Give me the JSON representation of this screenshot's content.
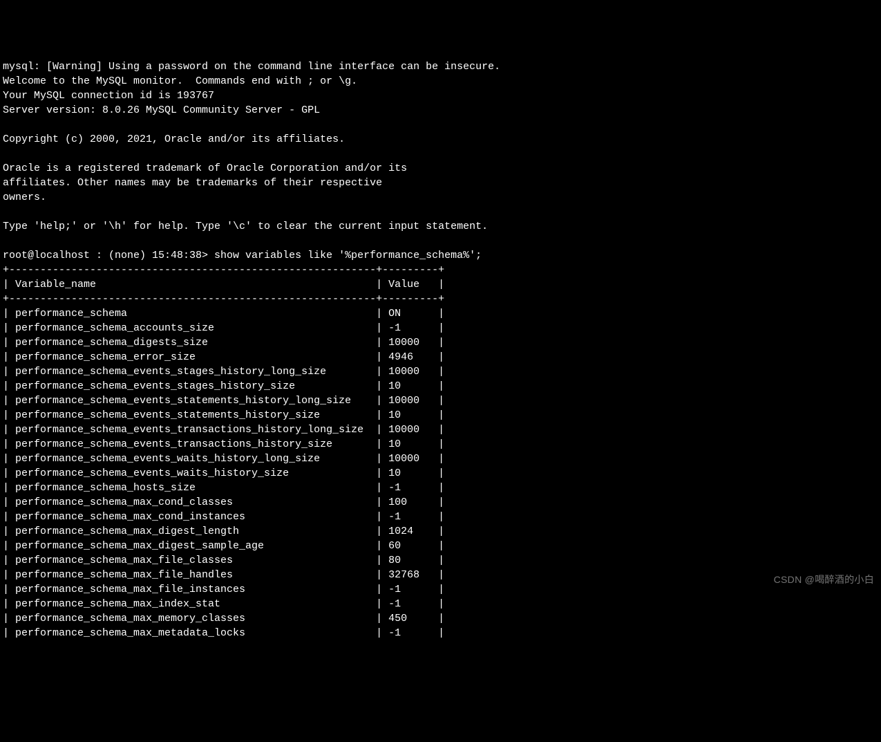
{
  "header_lines": [
    "mysql: [Warning] Using a password on the command line interface can be insecure.",
    "Welcome to the MySQL monitor.  Commands end with ; or \\g.",
    "Your MySQL connection id is 193767",
    "Server version: 8.0.26 MySQL Community Server - GPL",
    "",
    "Copyright (c) 2000, 2021, Oracle and/or its affiliates.",
    "",
    "Oracle is a registered trademark of Oracle Corporation and/or its",
    "affiliates. Other names may be trademarks of their respective",
    "owners.",
    "",
    "Type 'help;' or '\\h' for help. Type '\\c' to clear the current input statement.",
    ""
  ],
  "prompt_line": "root@localhost : (none) 15:48:38> show variables like '%performance_schema%';",
  "table": {
    "col1_header": "Variable_name",
    "col2_header": "Value",
    "col1_width": 57,
    "col2_width": 7,
    "rows": [
      {
        "name": "performance_schema",
        "value": "ON"
      },
      {
        "name": "performance_schema_accounts_size",
        "value": "-1"
      },
      {
        "name": "performance_schema_digests_size",
        "value": "10000"
      },
      {
        "name": "performance_schema_error_size",
        "value": "4946"
      },
      {
        "name": "performance_schema_events_stages_history_long_size",
        "value": "10000"
      },
      {
        "name": "performance_schema_events_stages_history_size",
        "value": "10"
      },
      {
        "name": "performance_schema_events_statements_history_long_size",
        "value": "10000"
      },
      {
        "name": "performance_schema_events_statements_history_size",
        "value": "10"
      },
      {
        "name": "performance_schema_events_transactions_history_long_size",
        "value": "10000"
      },
      {
        "name": "performance_schema_events_transactions_history_size",
        "value": "10"
      },
      {
        "name": "performance_schema_events_waits_history_long_size",
        "value": "10000"
      },
      {
        "name": "performance_schema_events_waits_history_size",
        "value": "10"
      },
      {
        "name": "performance_schema_hosts_size",
        "value": "-1"
      },
      {
        "name": "performance_schema_max_cond_classes",
        "value": "100"
      },
      {
        "name": "performance_schema_max_cond_instances",
        "value": "-1"
      },
      {
        "name": "performance_schema_max_digest_length",
        "value": "1024"
      },
      {
        "name": "performance_schema_max_digest_sample_age",
        "value": "60"
      },
      {
        "name": "performance_schema_max_file_classes",
        "value": "80"
      },
      {
        "name": "performance_schema_max_file_handles",
        "value": "32768"
      },
      {
        "name": "performance_schema_max_file_instances",
        "value": "-1"
      },
      {
        "name": "performance_schema_max_index_stat",
        "value": "-1"
      },
      {
        "name": "performance_schema_max_memory_classes",
        "value": "450"
      },
      {
        "name": "performance_schema_max_metadata_locks",
        "value": "-1"
      }
    ]
  },
  "watermark": "CSDN @喝醉酒的小白"
}
